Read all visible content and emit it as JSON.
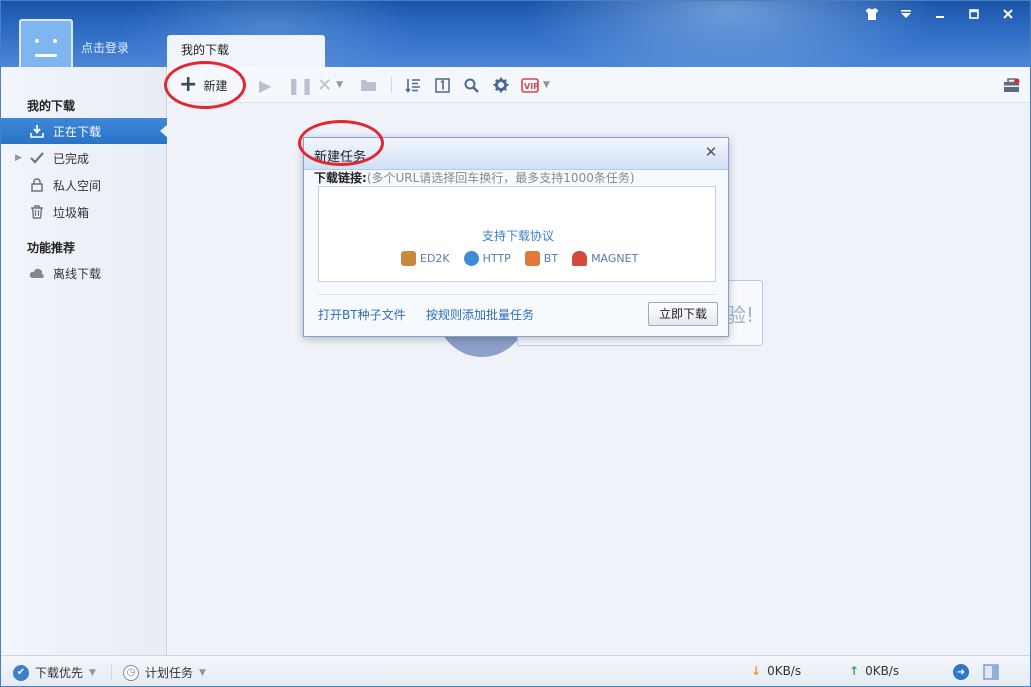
{
  "header": {
    "login_label": "点击登录",
    "tab_label": "我的下载",
    "window_controls": [
      "skin-icon",
      "menu-icon",
      "minimize-icon",
      "maximize-icon",
      "close-icon"
    ]
  },
  "sidebar": {
    "section_my": "我的下载",
    "items": [
      {
        "label": "正在下载",
        "icon": "download-icon"
      },
      {
        "label": "已完成",
        "icon": "check-icon"
      },
      {
        "label": "私人空间",
        "icon": "lock-icon"
      },
      {
        "label": "垃圾箱",
        "icon": "trash-icon"
      }
    ],
    "section_feature": "功能推荐",
    "feature_items": [
      {
        "label": "离线下载",
        "icon": "cloud-icon"
      }
    ]
  },
  "toolbar": {
    "new_label": "新建"
  },
  "background": {
    "bubble_text": "验!"
  },
  "dialog": {
    "title": "新建任务",
    "link_label": "下载链接:",
    "link_hint": "(多个URL请选择回车换行，最多支持1000条任务)",
    "protocols_title": "支持下载协议",
    "protocols": [
      "ED2K",
      "HTTP",
      "BT",
      "MAGNET"
    ],
    "open_bt_link": "打开BT种子文件",
    "batch_link": "按规则添加批量任务",
    "download_button": "立即下载"
  },
  "statusbar": {
    "priority_label": "下载优先",
    "schedule_label": "计划任务",
    "down_speed": "0KB/s",
    "up_speed": "0KB/s"
  },
  "colors": {
    "accent": "#2a72c6",
    "highlight_ring": "#e3262f",
    "link": "#2f6fb8"
  }
}
